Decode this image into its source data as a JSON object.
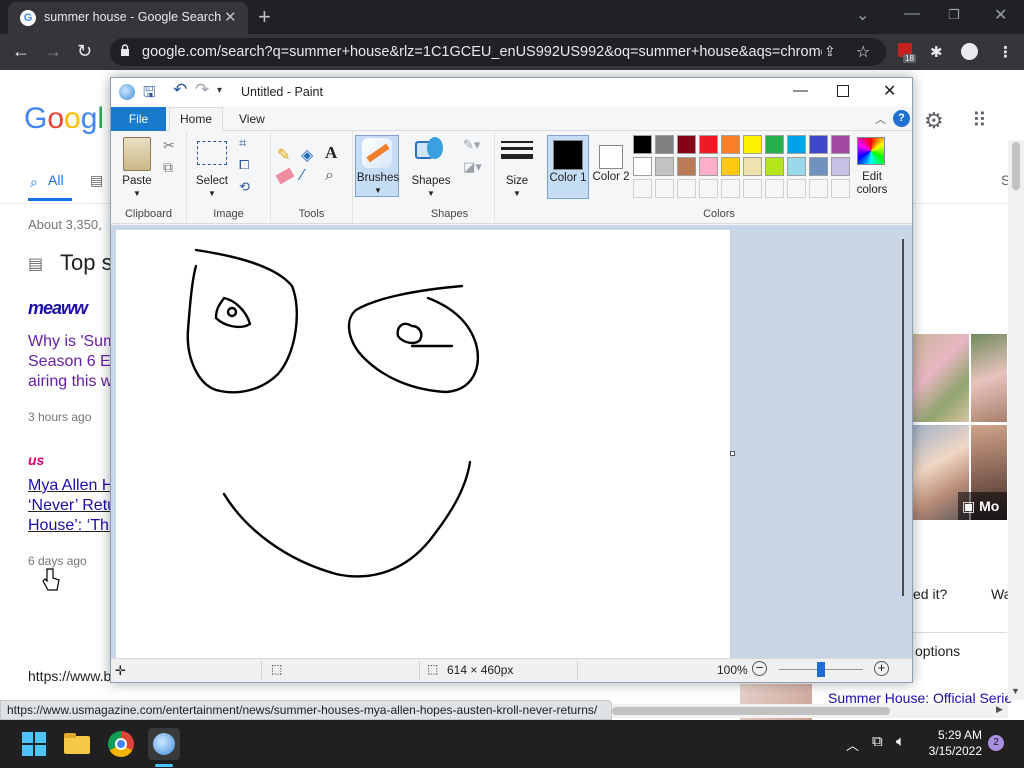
{
  "browser": {
    "tab_title": "summer house - Google Search",
    "url": "google.com/search?q=summer+house&rlz=1C1GCEU_enUS992US992&oq=summer+house&aqs=chrome....",
    "ext_badge": "18",
    "status_url": "https://www.usmagazine.com/entertainment/news/summer-houses-mya-allen-hopes-austen-kroll-never-returns/"
  },
  "google": {
    "logo": "Google",
    "tab_all": "All",
    "result_count": "About 3,350,",
    "top_stories": "Top s",
    "meaww_logo": "meaww",
    "story1_lines": [
      "Why is 'Sum",
      "Season 6 Ep",
      "airing this w"
    ],
    "story1_time": "3 hours ago",
    "us_logo": "us",
    "story2_lines": [
      "Mya Allen H",
      "‘Never’ Retu",
      "House’: ‘Thi"
    ],
    "story2_time": "6 days ago",
    "cite": "https://www.b",
    "right_more": "Mo",
    "right_q1": "ed it?",
    "right_q2": "Wa",
    "options": "options",
    "official": "Summer House: Official Serie",
    "right_s": "S"
  },
  "paint": {
    "title": "Untitled - Paint",
    "tabs": {
      "file": "File",
      "home": "Home",
      "view": "View"
    },
    "groups": {
      "clipboard": "Clipboard",
      "image": "Image",
      "tools": "Tools",
      "shapes": "Shapes",
      "colors": "Colors"
    },
    "buttons": {
      "paste": "Paste",
      "select": "Select",
      "brushes": "Brushes",
      "shapes": "Shapes",
      "size": "Size",
      "color1": "Color 1",
      "color2": "Color 2",
      "edit_colors": "Edit colors"
    },
    "palette_row1": [
      "#000000",
      "#7f7f7f",
      "#880015",
      "#ed1c24",
      "#ff7f27",
      "#fff200",
      "#22b14c",
      "#00a2e8",
      "#3f48cc",
      "#a349a4"
    ],
    "palette_row2": [
      "#ffffff",
      "#c3c3c3",
      "#b97a57",
      "#ffaec9",
      "#ffc90e",
      "#efe4b0",
      "#b5e61d",
      "#99d9ea",
      "#7092be",
      "#c8bfe7"
    ],
    "color1": "#000000",
    "color2": "#ffffff",
    "canvas_size": "614 × 460px",
    "zoom": "100%"
  },
  "taskbar": {
    "time": "5:29 AM",
    "date": "3/15/2022",
    "notif_count": "2"
  }
}
